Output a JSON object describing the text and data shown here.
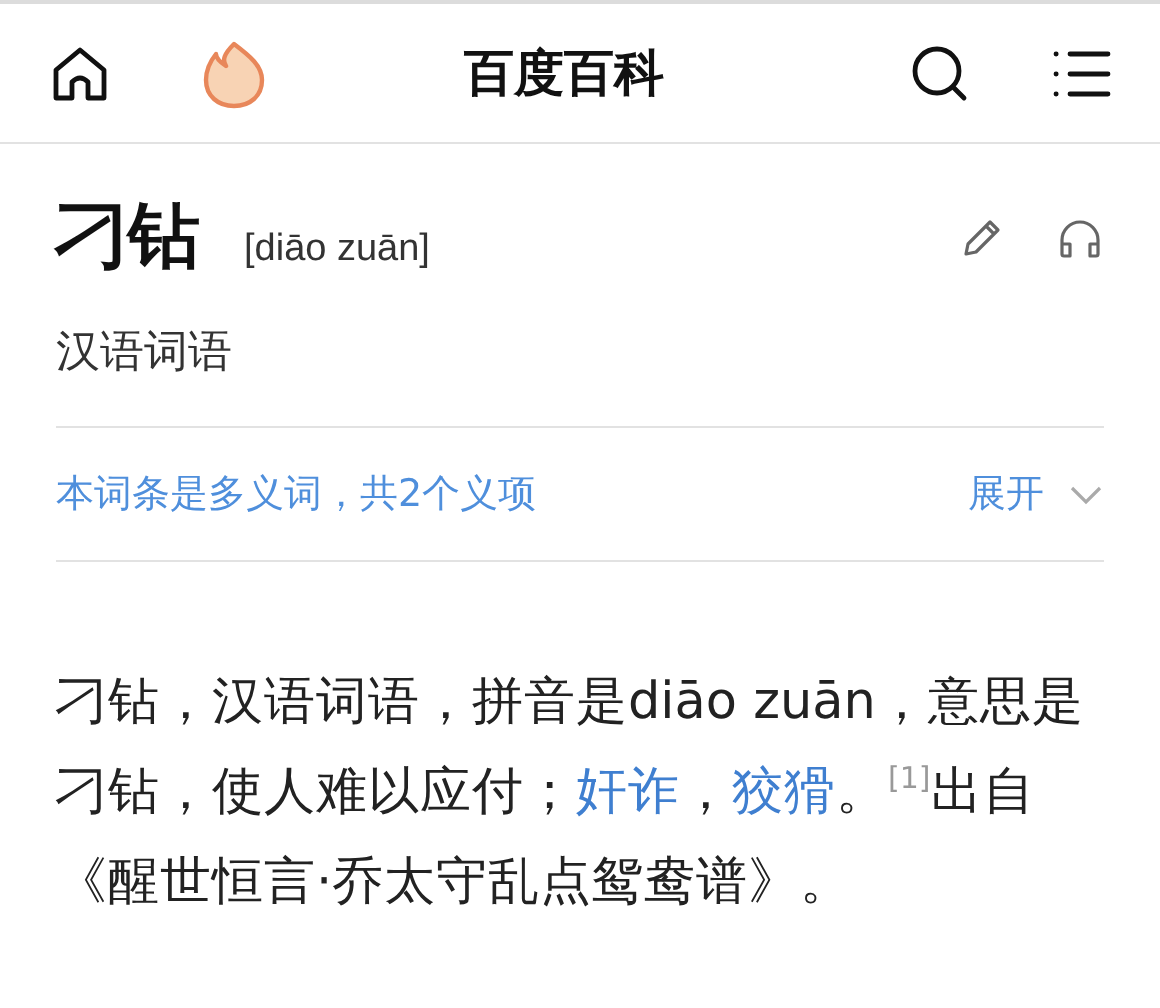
{
  "header": {
    "title": "百度百科"
  },
  "entry": {
    "title": "刁钻",
    "pinyin": "[diāo zuān]",
    "category": "汉语词语"
  },
  "polysemy": {
    "text": "本词条是多义词，共2个义项",
    "toggle": "展开",
    "expanded": false
  },
  "paragraph": [
    {
      "kind": "text",
      "text": "刁钻，汉语词语，拼音是diāo zuān，意思是刁钻，使人难以应付；"
    },
    {
      "kind": "link",
      "text": "奸诈"
    },
    {
      "kind": "text",
      "text": "，"
    },
    {
      "kind": "link",
      "text": "狡猾"
    },
    {
      "kind": "text",
      "text": "。"
    },
    {
      "kind": "ref",
      "text": "[1]"
    },
    {
      "kind": "text",
      "text": "出自《醒世恒言·乔太守乱点鸳鸯谱》。"
    }
  ]
}
